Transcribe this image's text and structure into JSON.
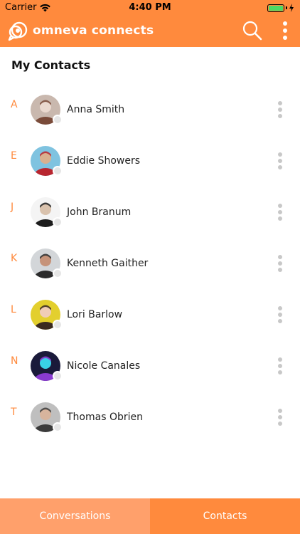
{
  "status_bar": {
    "carrier": "Carrier",
    "time": "4:40 PM"
  },
  "header": {
    "brand": "omneva connects",
    "icons": {
      "logo": "chat-bubble-logo-icon",
      "search": "search-icon",
      "menu": "more-vertical-icon"
    }
  },
  "page": {
    "title": "My Contacts"
  },
  "contacts": [
    {
      "letter": "A",
      "name": "Anna Smith",
      "avatar_colors": [
        "#c9b8ae",
        "#7a4b3a",
        "#ead9cf"
      ]
    },
    {
      "letter": "E",
      "name": "Eddie Showers",
      "avatar_colors": [
        "#7fc3e0",
        "#b8262f",
        "#d9b08f"
      ]
    },
    {
      "letter": "J",
      "name": "John Branum",
      "avatar_colors": [
        "#f4f4f4",
        "#1c1c1c",
        "#d9c2ad"
      ]
    },
    {
      "letter": "K",
      "name": "Kenneth Gaither",
      "avatar_colors": [
        "#d3d6d9",
        "#2b2b2b",
        "#c6937a"
      ]
    },
    {
      "letter": "L",
      "name": "Lori Barlow",
      "avatar_colors": [
        "#e3cf2e",
        "#3a2a1f",
        "#f0cdb6"
      ]
    },
    {
      "letter": "N",
      "name": "Nicole Canales",
      "avatar_colors": [
        "#1a1a3a",
        "#8a3bd1",
        "#39d0e6"
      ]
    },
    {
      "letter": "T",
      "name": "Thomas Obrien",
      "avatar_colors": [
        "#bfbfbf",
        "#3a3a3a",
        "#d7b49d"
      ]
    }
  ],
  "tabs": {
    "conversations": "Conversations",
    "contacts": "Contacts",
    "active": "contacts"
  },
  "colors": {
    "accent": "#ff8a3d",
    "accent_light": "#ffa06b",
    "status_dot": "#e6e6e6"
  }
}
